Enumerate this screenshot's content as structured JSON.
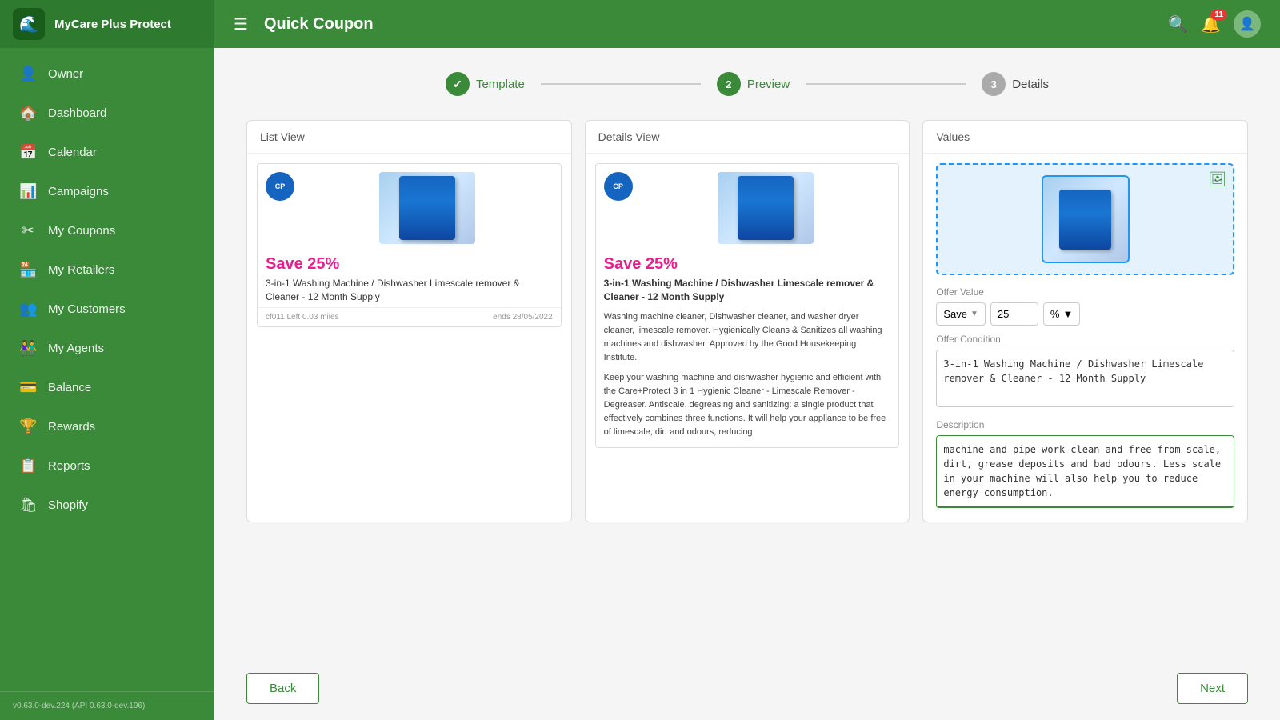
{
  "app": {
    "title": "MyCare Plus Protect",
    "logo_initial": "🌊"
  },
  "topbar": {
    "menu_icon": "☰",
    "title": "Quick Coupon",
    "notification_count": "11",
    "avatar_icon": "👤"
  },
  "sidebar": {
    "items": [
      {
        "id": "owner",
        "label": "Owner",
        "icon": "👤"
      },
      {
        "id": "dashboard",
        "label": "Dashboard",
        "icon": "🏠"
      },
      {
        "id": "calendar",
        "label": "Calendar",
        "icon": "📅"
      },
      {
        "id": "campaigns",
        "label": "Campaigns",
        "icon": "📊"
      },
      {
        "id": "my-coupons",
        "label": "My Coupons",
        "icon": "✂"
      },
      {
        "id": "my-retailers",
        "label": "My Retailers",
        "icon": "🏪"
      },
      {
        "id": "my-customers",
        "label": "My Customers",
        "icon": "👥"
      },
      {
        "id": "my-agents",
        "label": "My Agents",
        "icon": "👫"
      },
      {
        "id": "balance",
        "label": "Balance",
        "icon": "💳"
      },
      {
        "id": "rewards",
        "label": "Rewards",
        "icon": "🏆"
      },
      {
        "id": "reports",
        "label": "Reports",
        "icon": "📋"
      },
      {
        "id": "shopify",
        "label": "Shopify",
        "icon": "🛍"
      }
    ],
    "version": "v0.63.0-dev.224 (API 0.63.0-dev.196)"
  },
  "stepper": {
    "steps": [
      {
        "number": "✓",
        "label": "Template",
        "state": "check"
      },
      {
        "number": "2",
        "label": "Preview",
        "state": "active"
      },
      {
        "number": "3",
        "label": "Details",
        "state": "inactive"
      }
    ]
  },
  "list_view": {
    "header": "List View",
    "save_text": "Save 25%",
    "product_name": "3-in-1 Washing Machine / Dishwasher Limescale remover & Cleaner - 12 Month Supply",
    "meta_left": "cf011  Left  0.03 miles",
    "meta_right": "ends 28/05/2022"
  },
  "details_view": {
    "header": "Details View",
    "save_text": "Save 25%",
    "product_name": "3-in-1 Washing Machine / Dishwasher Limescale remover & Cleaner - 12 Month Supply",
    "description_1": "Washing machine cleaner, Dishwasher cleaner, and washer dryer cleaner, limescale remover. Hygienically Cleans & Sanitizes all washing machines and dishwasher. Approved by the Good Housekeeping Institute.",
    "description_2": "Keep your washing machine and dishwasher hygienic and efficient with the Care+Protect 3 in 1 Hygienic Cleaner - Limescale Remover - Degreaser. Antiscale, degreasing and sanitizing: a single product that effectively combines three functions. It will help your appliance to be free of limescale, dirt and odours, reducing"
  },
  "values": {
    "header": "Values",
    "offer_value_label": "Offer Value",
    "save_option": "Save",
    "amount": "25",
    "unit": "%",
    "offer_condition_label": "Offer Condition",
    "offer_condition_text": "3-in-1 Washing Machine / Dishwasher Limescale remover & Cleaner - 12 Month Supply",
    "description_label": "Description",
    "description_text": "machine and pipe work clean and free from scale, dirt, grease deposits and bad odours. Less scale in your machine will also help you to reduce energy consumption."
  },
  "buttons": {
    "back": "Back",
    "next": "Next"
  }
}
